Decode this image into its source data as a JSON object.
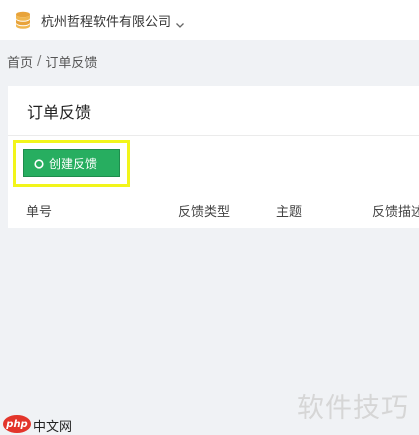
{
  "header": {
    "company_name": "杭州哲程软件有限公司",
    "company_icon": "database-stack-icon",
    "dropdown_icon": "chevron-down-icon"
  },
  "breadcrumb": {
    "home": "首页",
    "separator": "/",
    "current": "订单反馈"
  },
  "card": {
    "title": "订单反馈",
    "create_button_label": "创建反馈",
    "create_button_icon": "circle-icon",
    "button_color": "#27ae60",
    "highlight_color": "#f2f51a"
  },
  "table": {
    "columns": [
      "单号",
      "反馈类型",
      "主题",
      "反馈描述"
    ]
  },
  "watermark": {
    "text": "软件技巧",
    "logo_badge": "php",
    "logo_text": "中文网"
  }
}
